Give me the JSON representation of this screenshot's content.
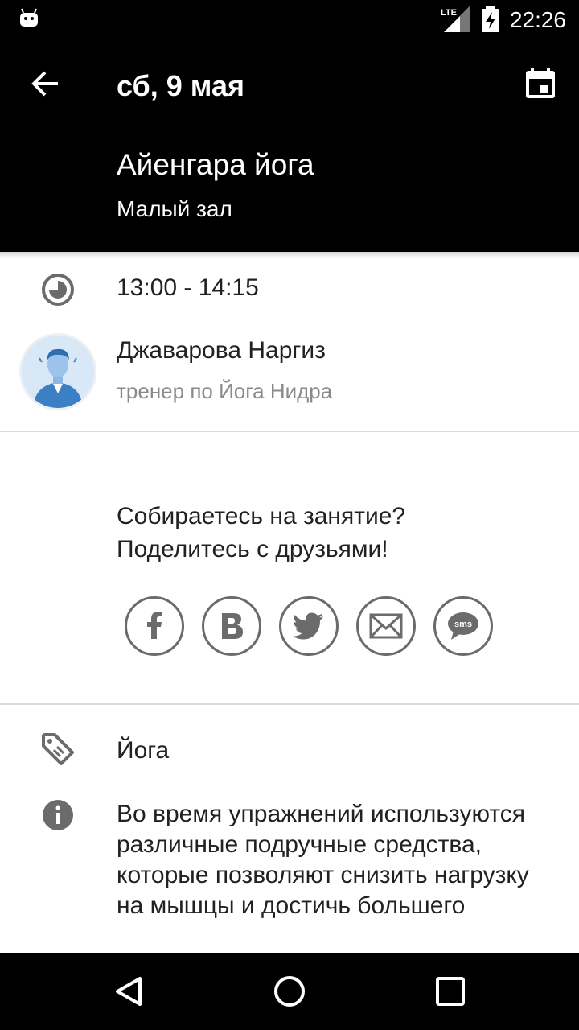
{
  "status_bar": {
    "time": "22:26",
    "network": "LTE",
    "icons": [
      "android-notification-icon",
      "lte-signal-icon",
      "battery-charging-icon"
    ]
  },
  "header": {
    "date": "сб, 9 мая",
    "class_title": "Айенгара йога",
    "room": "Малый зал",
    "icons": [
      "back-arrow-icon",
      "calendar-icon"
    ]
  },
  "details": {
    "time_range": "13:00 - 14:15",
    "trainer": {
      "name": "Джаварова Наргиз",
      "role": "тренер по Йога Нидра"
    }
  },
  "share": {
    "prompt_line1": "Собираетесь на занятие?",
    "prompt_line2": "Поделитесь с друзьями!",
    "buttons": [
      {
        "name": "facebook",
        "glyph": "f"
      },
      {
        "name": "vkontakte",
        "glyph": "B"
      },
      {
        "name": "twitter",
        "glyph": "twitter-bird"
      },
      {
        "name": "email",
        "glyph": "envelope"
      },
      {
        "name": "sms",
        "glyph": "sms"
      }
    ]
  },
  "category": {
    "label": "Йога"
  },
  "description": {
    "text": "Во время упражнений используются различные подручные средства, которые позволяют снизить нагрузку на мышцы и достичь большего"
  },
  "nav_bar": {
    "icons": [
      "back-triangle-icon",
      "home-circle-icon",
      "recents-square-icon"
    ]
  },
  "colors": {
    "header_bg": "#000000",
    "content_bg": "#ffffff",
    "icon_gray": "#6b6b6b",
    "secondary_text": "#8a8a8a",
    "avatar_blue": "#3b7fc4"
  }
}
